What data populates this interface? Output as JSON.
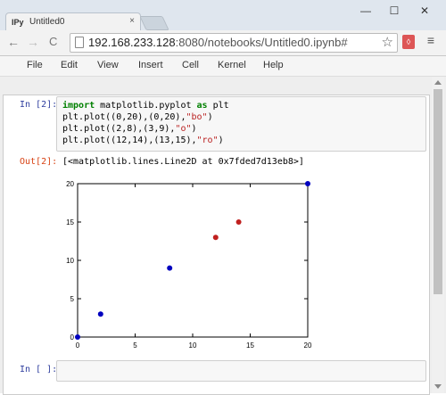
{
  "browser": {
    "tab_favicon": "IPy",
    "tab_title": "Untitled0",
    "tab_close": "×",
    "url_host": "192.168.233.128",
    "url_rest": ":8080/notebooks/Untitled0.ipynb#",
    "win_minimize": "—",
    "win_maximize": "☐",
    "win_close": "✕",
    "nav_back": "←",
    "nav_forward": "→",
    "nav_reload": "C",
    "star": "☆",
    "menu": "≡"
  },
  "notebook_menu": [
    "File",
    "Edit",
    "View",
    "Insert",
    "Cell",
    "Kernel",
    "Help"
  ],
  "cells": {
    "in_prompt": "In [2]:",
    "code": {
      "line1_kw1": "import",
      "line1_mid": " matplotlib.pyplot ",
      "line1_kw2": "as",
      "line1_end": " plt",
      "line2_a": "plt.plot((0,20),(0,20),",
      "line2_s": "\"bo\"",
      "line2_b": ")",
      "line3_a": "plt.plot((2,8),(3,9),",
      "line3_s": "\"o\"",
      "line3_b": ")",
      "line4_a": "plt.plot((12,14),(13,15),",
      "line4_s": "\"ro\"",
      "line4_b": ")"
    },
    "out_prompt": "Out[2]:",
    "out_text": "[<matplotlib.lines.Line2D at 0x7fded7d13eb8>]",
    "empty_prompt": "In [ ]:"
  },
  "chart_data": {
    "type": "scatter",
    "xlim": [
      0,
      20
    ],
    "ylim": [
      0,
      20
    ],
    "xticks": [
      0,
      5,
      10,
      15,
      20
    ],
    "yticks": [
      0,
      5,
      10,
      15,
      20
    ],
    "grid": false,
    "series": [
      {
        "x": [
          0,
          20
        ],
        "y": [
          0,
          20
        ],
        "color": "#0000bf"
      },
      {
        "x": [
          2,
          8
        ],
        "y": [
          3,
          9
        ],
        "color": "#0000bf"
      },
      {
        "x": [
          12,
          14
        ],
        "y": [
          13,
          15
        ],
        "color": "#c0201f"
      }
    ]
  }
}
